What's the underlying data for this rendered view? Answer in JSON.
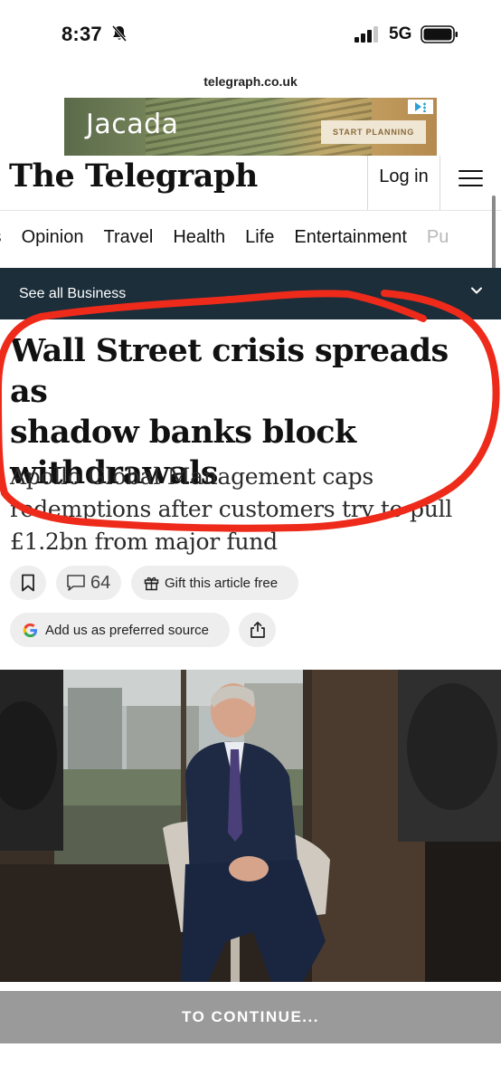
{
  "status_bar": {
    "time": "8:37",
    "network": "5G",
    "icons": [
      "bell-slash-icon",
      "signal-icon",
      "battery-icon"
    ]
  },
  "browser": {
    "url": "telegraph.co.uk"
  },
  "ad": {
    "brand": "Jacada",
    "cta": "START PLANNING",
    "icons": [
      "ad-choices-icon"
    ]
  },
  "header": {
    "logo": "The Telegraph",
    "login_label": "Log in",
    "icons": [
      "menu-icon"
    ]
  },
  "nav": {
    "items": [
      "ts",
      "Opinion",
      "Travel",
      "Health",
      "Life",
      "Entertainment",
      "Pu"
    ]
  },
  "section_bar": {
    "label": "See all Business",
    "icons": [
      "chevron-down-icon"
    ]
  },
  "article": {
    "headline_lines": [
      "Wall Street crisis spreads as",
      "shadow banks block",
      "withdrawals"
    ],
    "standfirst_lines": [
      "Apollo Global Management caps",
      "redemptions after customers try to pull",
      "£1.2bn from major fund"
    ],
    "comment_count": "64",
    "gift_label": "Gift this article free",
    "preferred_source_label": "Add us as preferred source"
  },
  "overlay": {
    "continue_label": "TO CONTINUE..."
  },
  "colors": {
    "section_bar": "#1b2e3a",
    "annotation_red": "#ee2a1b",
    "continue_bar": "#9a9a9a"
  }
}
